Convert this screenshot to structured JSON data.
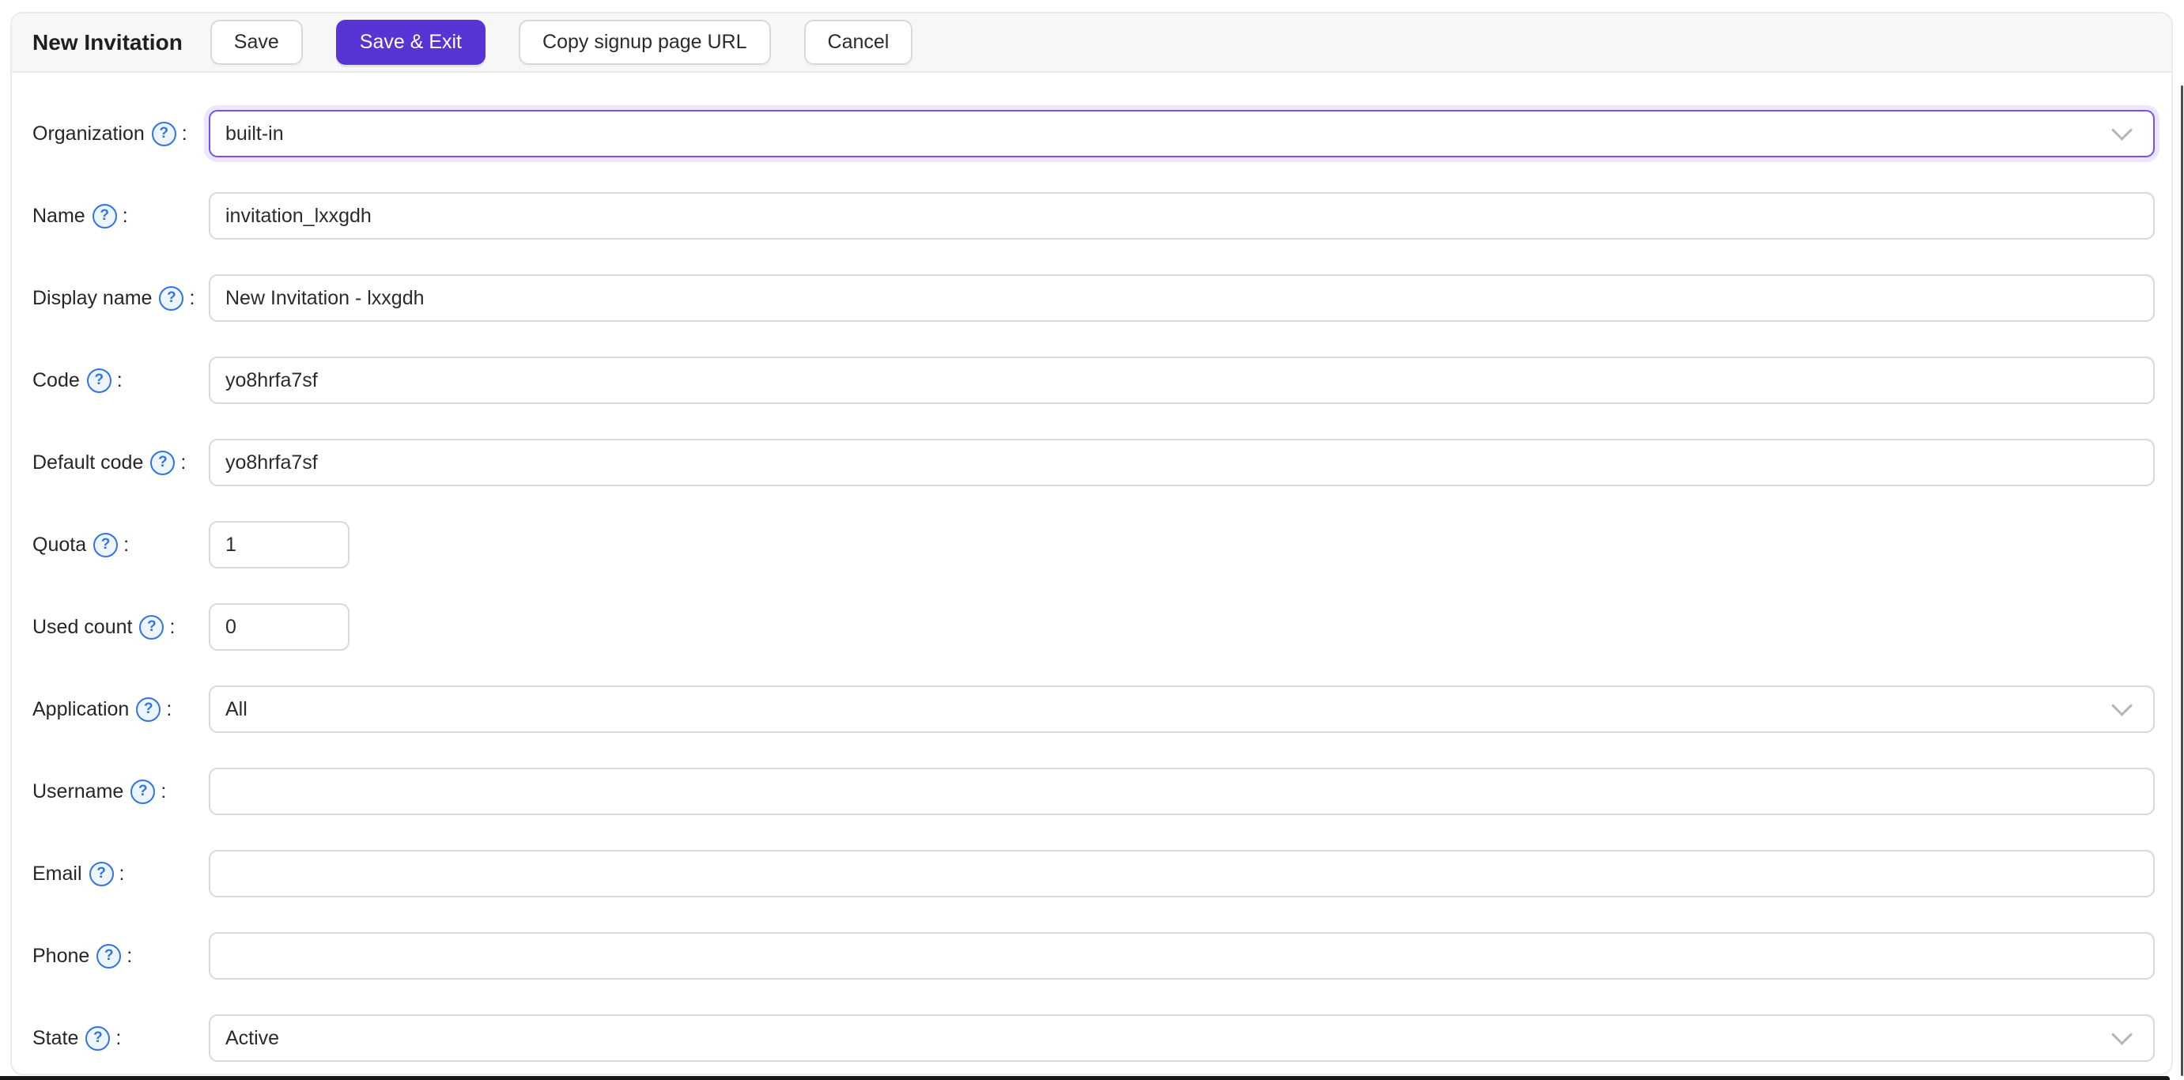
{
  "toolbar": {
    "title": "New Invitation",
    "save_label": "Save",
    "save_exit_label": "Save & Exit",
    "copy_url_label": "Copy signup page URL",
    "cancel_label": "Cancel"
  },
  "form": {
    "label_suffix": ":",
    "fields": [
      {
        "label": "Organization",
        "type": "select",
        "value": "built-in",
        "state": "focused"
      },
      {
        "label": "Name",
        "type": "text",
        "value": "invitation_lxxgdh"
      },
      {
        "label": "Display name",
        "type": "text",
        "value": "New Invitation - lxxgdh"
      },
      {
        "label": "Code",
        "type": "text",
        "value": "yo8hrfa7sf"
      },
      {
        "label": "Default code",
        "type": "text",
        "value": "yo8hrfa7sf"
      },
      {
        "label": "Quota",
        "type": "number",
        "value": "1"
      },
      {
        "label": "Used count",
        "type": "number",
        "value": "0"
      },
      {
        "label": "Application",
        "type": "select",
        "value": "All"
      },
      {
        "label": "Username",
        "type": "text",
        "value": ""
      },
      {
        "label": "Email",
        "type": "text",
        "value": ""
      },
      {
        "label": "Phone",
        "type": "text",
        "value": ""
      },
      {
        "label": "State",
        "type": "select",
        "value": "Active"
      }
    ]
  },
  "icons": {
    "help": "?",
    "dropdown": "chevron-down"
  },
  "colors": {
    "primary": "#5734d3",
    "focus_border": "#7b50f0",
    "help_icon_blue": "#2f74e8",
    "input_border": "#d9d9d9"
  }
}
